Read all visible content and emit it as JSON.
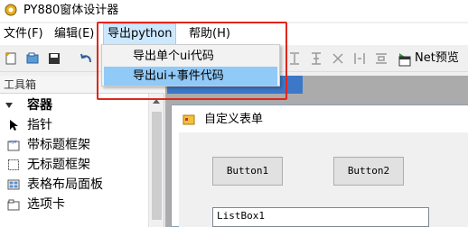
{
  "window": {
    "title": "PY880窗体设计器",
    "icon": "app-gear-icon"
  },
  "menubar": {
    "items": [
      {
        "label": "文件(F)"
      },
      {
        "label": "编辑(E)"
      },
      {
        "label": "导出python"
      },
      {
        "label": "帮助(H)"
      }
    ]
  },
  "dropdown": {
    "items": [
      {
        "label": "导出单个ui代码"
      },
      {
        "label": "导出ui+事件代码"
      }
    ]
  },
  "toolbar": {
    "net_preview_label": "Net预览"
  },
  "toolbox": {
    "header": "工具箱",
    "group_label": "容器",
    "items": [
      {
        "label": "指针",
        "icon": "pointer-icon"
      },
      {
        "label": "带标题框架",
        "icon": "groupbox-icon"
      },
      {
        "label": "无标题框架",
        "icon": "panel-icon"
      },
      {
        "label": "表格布局面板",
        "icon": "table-layout-icon"
      },
      {
        "label": "选项卡",
        "icon": "tab-control-icon"
      }
    ]
  },
  "form": {
    "title": "自定义表单",
    "button1": "Button1",
    "button2": "Button2",
    "listbox": "ListBox1"
  },
  "colors": {
    "annotation_red": "#e0261b",
    "menu_hover": "#cce8ff",
    "dropdown_highlight": "#91c9f7",
    "design_tab": "#3c78c8"
  }
}
